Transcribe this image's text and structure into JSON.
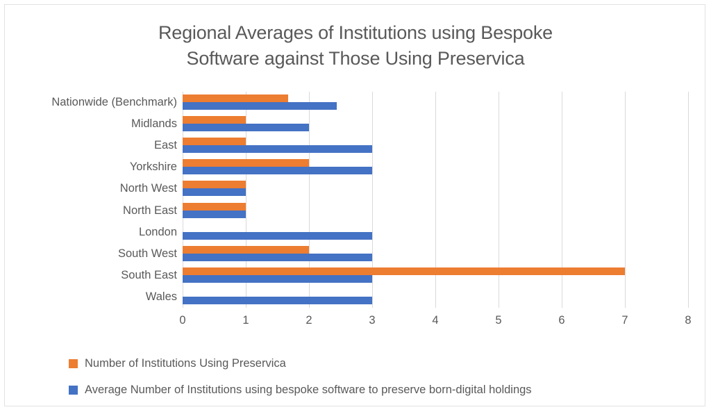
{
  "chart_data": {
    "type": "bar",
    "orientation": "horizontal",
    "title": "Regional Averages of Institutions using Bespoke Software against Those Using Preservica",
    "title_lines": [
      "Regional Averages of Institutions using Bespoke",
      "Software against Those Using Preservica"
    ],
    "xlabel": "",
    "ylabel": "",
    "xlim": [
      0,
      8
    ],
    "xticks": [
      "0",
      "1",
      "2",
      "3",
      "4",
      "5",
      "6",
      "7",
      "8"
    ],
    "xtick_step": 1,
    "grid": "vertical",
    "legend_position": "bottom-left",
    "categories": [
      "Nationwide (Benchmark)",
      "Midlands",
      "East",
      "Yorkshire",
      "North West",
      "North East",
      "London",
      "South West",
      "South East",
      "Wales"
    ],
    "series": [
      {
        "name": "Number of Institutions Using Preservica",
        "color": "#ED7D31",
        "values": [
          1.67,
          1,
          1,
          2,
          1,
          1,
          0,
          2,
          7,
          0
        ]
      },
      {
        "name": "Average Number of Institutions using bespoke software to preserve born-digital holdings",
        "color": "#4472C4",
        "values": [
          2.44,
          2,
          3,
          3,
          1,
          1,
          3,
          3,
          3,
          3
        ]
      }
    ]
  },
  "legend": {
    "entries": [
      {
        "label": "Number of Institutions Using Preservica",
        "color": "#ED7D31",
        "swatch_name": "legend-swatch-preservica"
      },
      {
        "label": "Average Number of Institutions using bespoke software to preserve born-digital holdings",
        "color": "#4472C4",
        "swatch_name": "legend-swatch-bespoke"
      }
    ]
  },
  "colors": {
    "series_preservica": "#ED7D31",
    "series_bespoke": "#4472C4",
    "text": "#595959",
    "gridline": "#D9D9D9",
    "border": "#E2E2E2",
    "background": "#FFFFFF"
  }
}
